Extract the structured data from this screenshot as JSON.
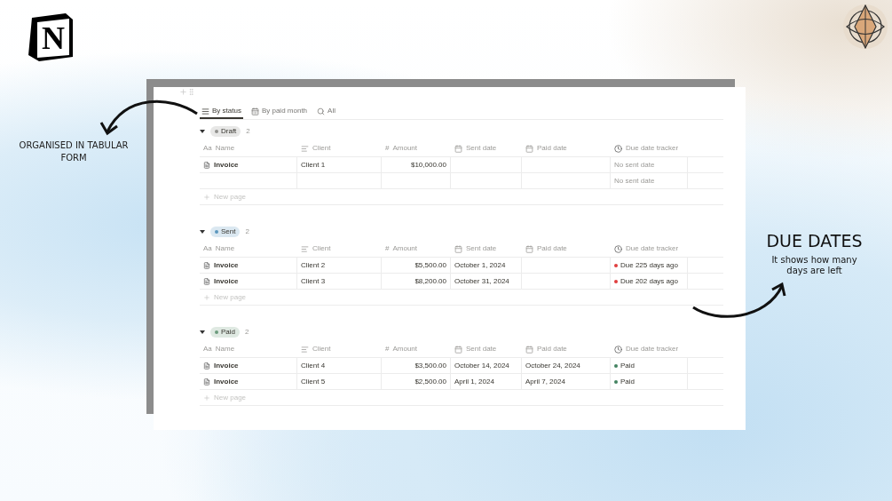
{
  "logo": {
    "letter": "N"
  },
  "annotation_left": {
    "text": "ORGANISED IN TABULAR FORM"
  },
  "annotation_right": {
    "title": "DUE DATES",
    "text": "It shows how many days are left"
  },
  "views": [
    {
      "kind": "list",
      "label": "By status",
      "selected": true
    },
    {
      "kind": "calendar",
      "label": "By paid month",
      "selected": false
    },
    {
      "kind": "search",
      "label": "All",
      "selected": false
    }
  ],
  "groups": [
    {
      "label": "Draft",
      "color": "#91918e",
      "count": "2",
      "expanded": true,
      "new_page": "New page",
      "columns": [
        {
          "kind": "title",
          "icon": "Aa",
          "label": "Name"
        },
        {
          "kind": "text",
          "label": "Client"
        },
        {
          "kind": "number",
          "icon": "#",
          "label": "Amount"
        },
        {
          "kind": "date",
          "label": "Sent date"
        },
        {
          "kind": "date",
          "label": "Paid date"
        },
        {
          "kind": "formula",
          "label": "Due date tracker"
        }
      ],
      "rows": [
        {
          "name": "Invoice",
          "client": "Client 1",
          "amount": "$10,000.00",
          "tracker": {
            "text": "No sent date"
          }
        },
        {
          "tracker": {
            "text": "No sent date"
          }
        }
      ]
    },
    {
      "label": "Sent",
      "color": "#5b97bd",
      "count": "2",
      "expanded": true,
      "new_page": "New page",
      "columns": [
        {
          "kind": "title",
          "icon": "Aa",
          "label": "Name"
        },
        {
          "kind": "text",
          "label": "Client"
        },
        {
          "kind": "number",
          "icon": "#",
          "label": "Amount"
        },
        {
          "kind": "date",
          "label": "Sent date"
        },
        {
          "kind": "date",
          "label": "Paid date"
        },
        {
          "kind": "formula",
          "label": "Due date tracker"
        }
      ],
      "rows": [
        {
          "name": "Invoice",
          "client": "Client 2",
          "amount": "$5,500.00",
          "sent_date": "October 1, 2024",
          "tracker": {
            "text": "Due 225 days ago",
            "color": "#e03e3e"
          }
        },
        {
          "name": "Invoice",
          "client": "Client 3",
          "amount": "$8,200.00",
          "sent_date": "October 31, 2024",
          "tracker": {
            "text": "Due 202 days ago",
            "color": "#e03e3e"
          }
        }
      ]
    },
    {
      "label": "Paid",
      "color": "#6c9b7d",
      "count": "2",
      "expanded": true,
      "new_page": "New page",
      "columns": [
        {
          "kind": "title",
          "icon": "Aa",
          "label": "Name"
        },
        {
          "kind": "text",
          "label": "Client"
        },
        {
          "kind": "number",
          "icon": "#",
          "label": "Amount"
        },
        {
          "kind": "date",
          "label": "Sent date"
        },
        {
          "kind": "date",
          "label": "Paid date"
        },
        {
          "kind": "formula",
          "label": "Due date tracker"
        }
      ],
      "rows": [
        {
          "name": "Invoice",
          "client": "Client 4",
          "amount": "$3,500.00",
          "sent_date": "October 14, 2024",
          "paid_date": "October 24, 2024",
          "tracker": {
            "text": "Paid",
            "color": "#448361"
          }
        },
        {
          "name": "Invoice",
          "client": "Client 5",
          "amount": "$2,500.00",
          "sent_date": "April 1, 2024",
          "paid_date": "April 7, 2024",
          "tracker": {
            "text": "Paid",
            "color": "#448361"
          }
        }
      ]
    }
  ]
}
